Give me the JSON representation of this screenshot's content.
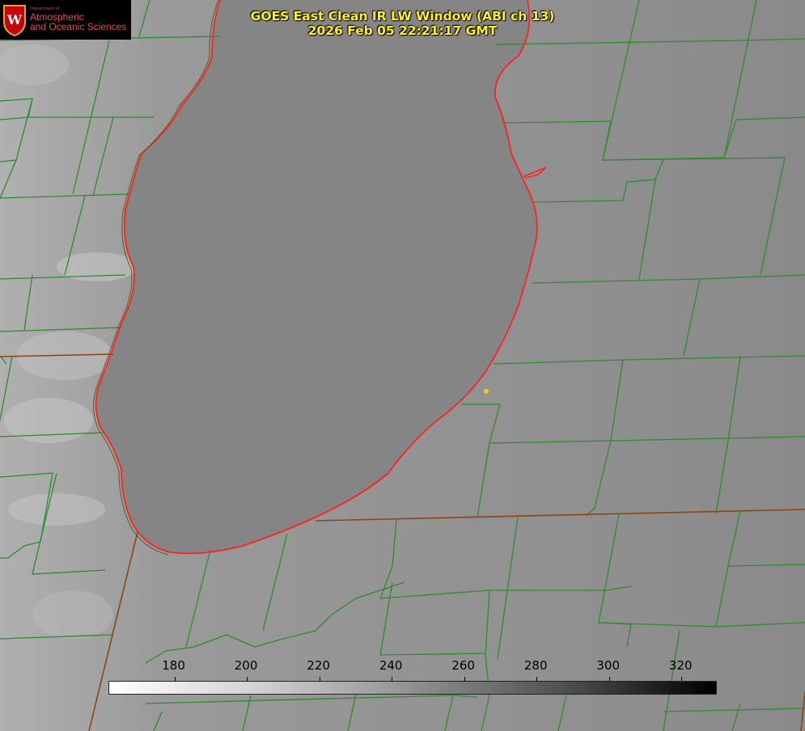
{
  "title": {
    "line1": "GOES East Clean IR LW Window (ABI ch 13)",
    "line2": "2026 Feb 05 22:21:17 GMT"
  },
  "logo": {
    "dept": "Department of",
    "line1": "Atmospheric",
    "line2": "and Oceanic Sciences",
    "seal_letter": "W"
  },
  "colorbar": {
    "ticks": [
      "180",
      "200",
      "220",
      "240",
      "260",
      "280",
      "300",
      "320"
    ],
    "min": 162,
    "max": 330,
    "colors": {
      "low": "#ffffff",
      "high": "#000000"
    }
  },
  "colors": {
    "county_lines": "#2e8b2e",
    "state_lines": "#8b4513",
    "lake_outline": "#ff2020",
    "marker": "#e6d21e",
    "title": "#ffef2a"
  }
}
